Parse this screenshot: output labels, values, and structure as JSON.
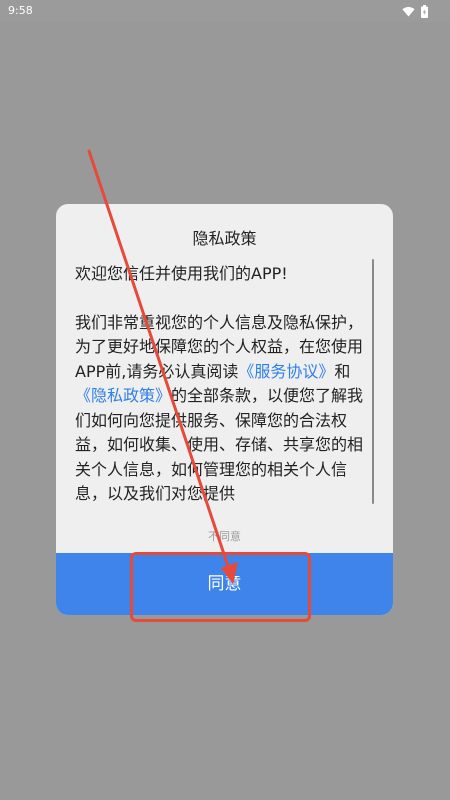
{
  "status_bar": {
    "time": "9:58",
    "icons": [
      "wifi-icon",
      "battery-icon"
    ]
  },
  "dialog": {
    "title": "隐私政策",
    "welcome": "欢迎您信任并使用我们的APP!",
    "paragraph_before_link_1": "我们非常重视您的个人信息及隐私保护，为了更好地保障您的个人权益，在您使用APP前,请务必认真阅读",
    "link_1": "《服务协议》",
    "between_links": "和",
    "link_2": "《隐私政策》",
    "paragraph_after_links": "的全部条款，以便您了解我们如何向您提供服务、保障您的合法权益，如何收集、使用、存储、共享您的相关个人信息，如何管理您的相关个人信息，以及我们对您提供",
    "disagree_label": "不同意",
    "agree_label": "同意"
  },
  "colors": {
    "overlay": "#999999",
    "dialog_background": "#efefef",
    "link": "#2f7fe8",
    "agree_button": "#3f84ea",
    "annotation": "#e64a3b"
  }
}
